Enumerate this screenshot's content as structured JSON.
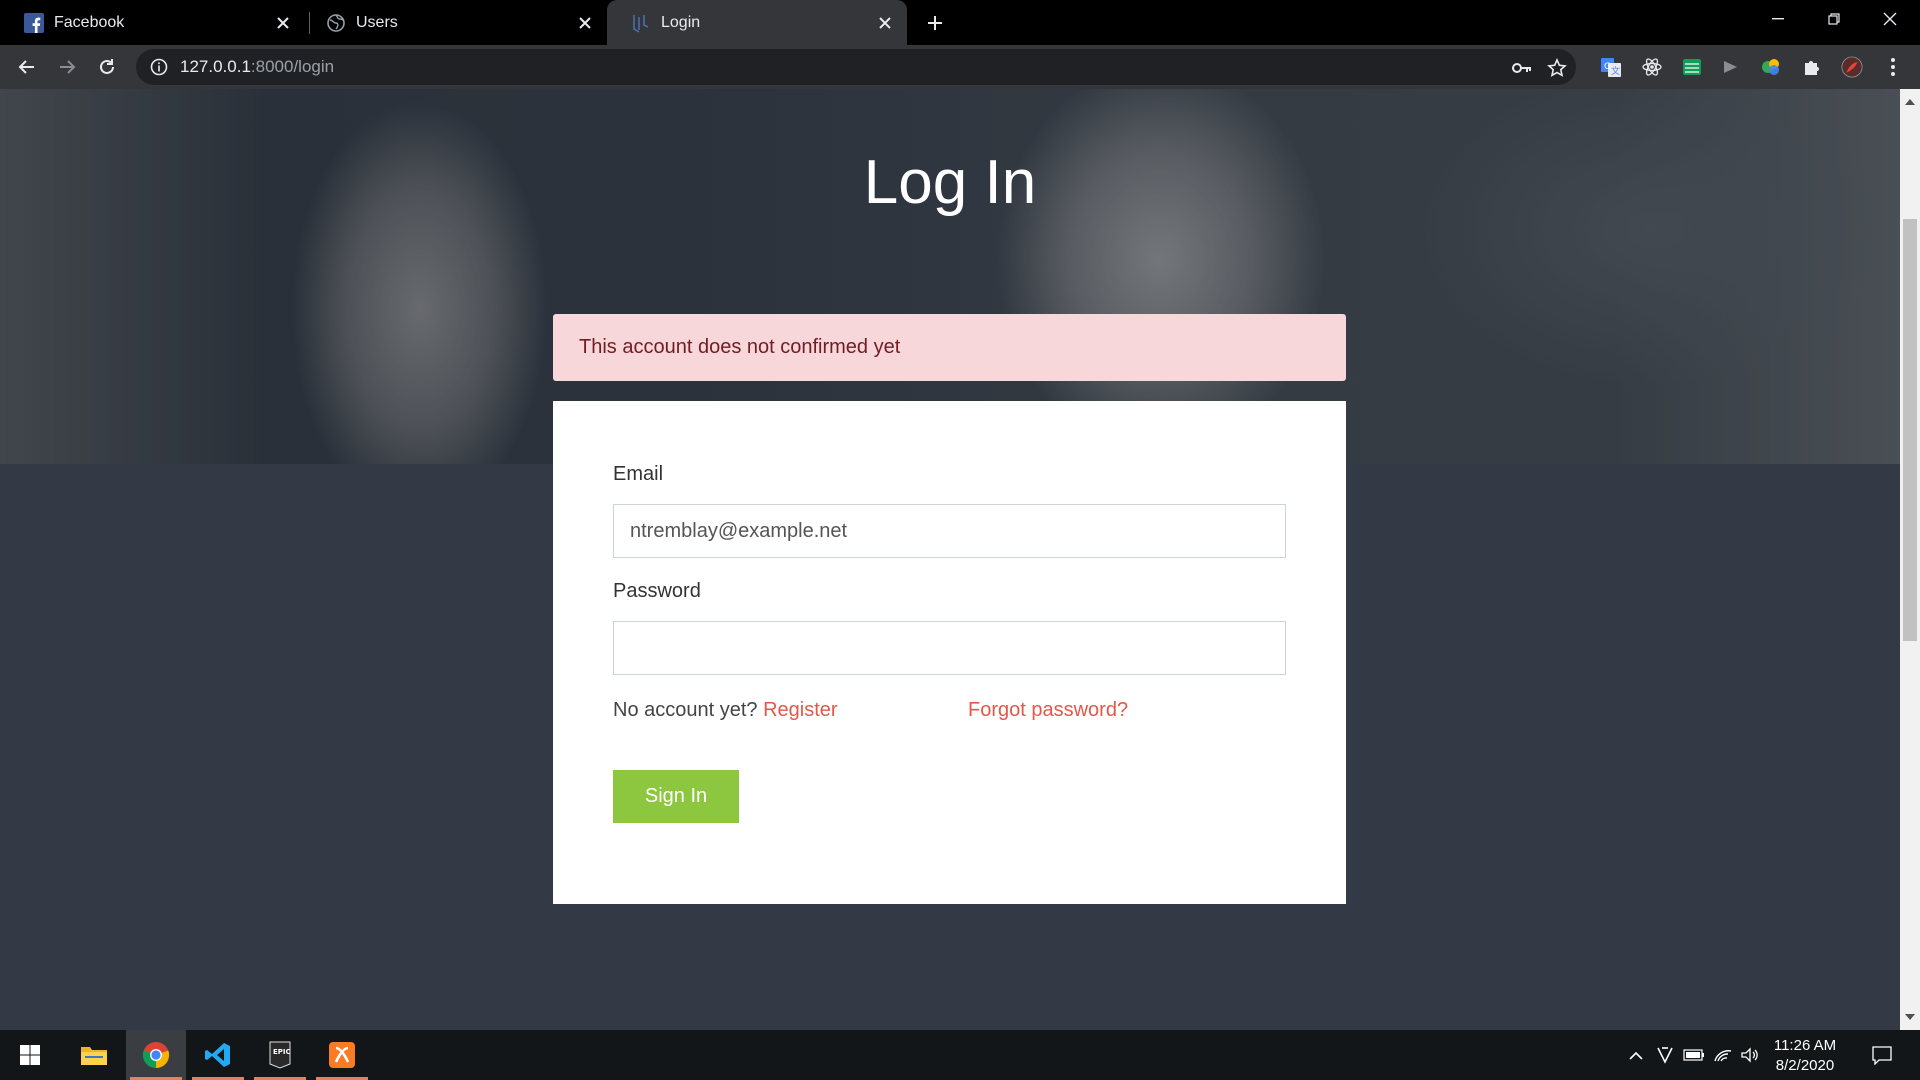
{
  "browser": {
    "tabs": [
      {
        "title": "Facebook",
        "favicon": "facebook-icon",
        "active": false
      },
      {
        "title": "Users",
        "favicon": "globe-icon",
        "active": false
      },
      {
        "title": "Login",
        "favicon": "laravel-icon",
        "active": true
      }
    ],
    "url_host": "127.0.0.1",
    "url_rest": ":8000/login",
    "extensions": [
      "google-translate-icon",
      "react-devtools-icon",
      "sheets-icon",
      "cast-icon",
      "color-picker-icon",
      "extensions-puzzle-icon",
      "profile-avatar-icon"
    ]
  },
  "page": {
    "title": "Log In",
    "alert": "This account does not confirmed yet",
    "email_label": "Email",
    "email_value": "ntremblay@example.net",
    "password_label": "Password",
    "no_account_text": "No account yet?",
    "register_link": "Register",
    "forgot_link": "Forgot password?",
    "signin_button": "Sign In"
  },
  "colors": {
    "alert_bg": "#f8d7da",
    "alert_text": "#721c24",
    "link": "#e2584a",
    "button": "#8dc63f",
    "page_bg": "#343a45"
  },
  "taskbar": {
    "apps": [
      "windows-start-icon",
      "file-explorer-icon",
      "chrome-icon",
      "vscode-icon",
      "epic-games-icon",
      "xampp-icon"
    ],
    "time": "11:26 AM",
    "date": "8/2/2020"
  }
}
